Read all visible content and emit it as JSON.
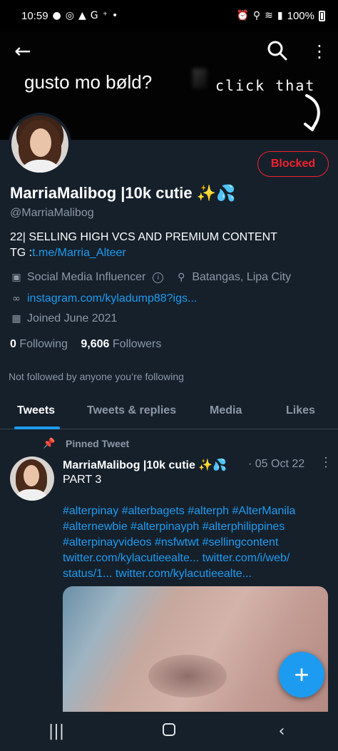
{
  "status_bar": {
    "time": "10:59",
    "notif_icons": [
      "chat-bubble-icon",
      "messenger-icon",
      "warning-icon",
      "google-icon",
      "add-person-icon",
      "dot-icon"
    ],
    "battery_text": "100%",
    "system_icons": [
      "alarm-icon",
      "location-icon",
      "wifi-icon",
      "signal-icon",
      "call-wifi-icon",
      "signal-icon",
      "battery-icon"
    ]
  },
  "header": {
    "banner_text_left": "gusto mo bøld?",
    "banner_text_right": "click that"
  },
  "profile": {
    "display_name": "MarriaMalibog |10k cutie ✨💦",
    "handle": "@MarriaMalibog",
    "bio_line1": "22| SELLING HIGH VCS AND PREMIUM CONTENT",
    "bio_line2_prefix": "TG :",
    "bio_line2_link": "t.me/Marria_Alteer",
    "category": "Social Media Influencer",
    "location": "Batangas, Lipa City",
    "website": "instagram.com/kyladump88?igs...",
    "joined": "Joined June 2021",
    "following_count": "0",
    "following_label": "Following",
    "followers_count": "9,606",
    "followers_label": "Followers",
    "not_followed_text": "Not followed by anyone you’re following",
    "blocked_label": "Blocked"
  },
  "tabs": [
    {
      "label": "Tweets",
      "active": true
    },
    {
      "label": "Tweets & replies",
      "active": false
    },
    {
      "label": "Media",
      "active": false
    },
    {
      "label": "Likes",
      "active": false
    }
  ],
  "pinned_tweet": {
    "pinned_label": "Pinned Tweet",
    "author": "MarriaMalibog |10k cutie ✨💦",
    "date": "· 05 Oct 22",
    "text": "PART 3",
    "tags_line1": "#alterpinay #alterbagets #alterph #AlterManila",
    "tags_line2": "#alternewbie #alterpinayph #alterphilippines",
    "tags_line3": "#alterpinayvideos #nsfwtwt #sellingcontent",
    "tags_line4": "twitter.com/kylacutieealte... twitter.com/i/web/",
    "tags_line5": "status/1... twitter.com/kylacutieealte..."
  },
  "fab_label": "+",
  "colors": {
    "background": "#15202b",
    "accent": "#1d9bf0",
    "blocked": "#f4212e",
    "secondary_text": "#8b98a5"
  }
}
